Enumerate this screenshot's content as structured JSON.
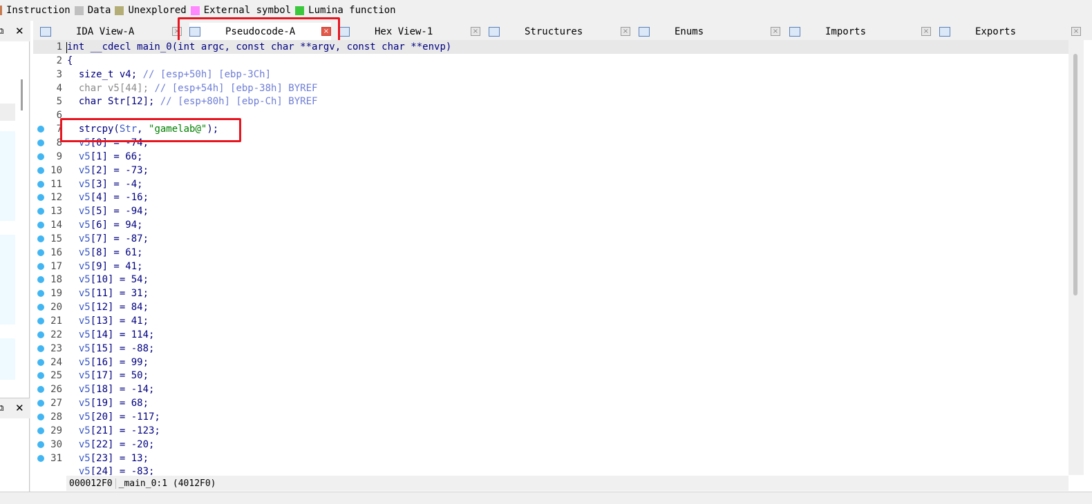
{
  "legend": {
    "items": [
      {
        "label": "Instruction",
        "color": "#c87b52"
      },
      {
        "label": "Data",
        "color": "#c0c0c0"
      },
      {
        "label": "Unexplored",
        "color": "#b4ae76"
      },
      {
        "label": "External symbol",
        "color": "#ff88ff"
      },
      {
        "label": "Lumina function",
        "color": "#3cc83c"
      }
    ]
  },
  "tabs": [
    {
      "label": "IDA View-A",
      "icon": "ida-view-icon",
      "close": "×"
    },
    {
      "label": "Pseudocode-A",
      "icon": "pseudocode-icon",
      "close": "×"
    },
    {
      "label": "Hex View-1",
      "icon": "hex-view-icon",
      "close": "×"
    },
    {
      "label": "Structures",
      "icon": "structures-icon",
      "close": "×"
    },
    {
      "label": "Enums",
      "icon": "enums-icon",
      "close": "×"
    },
    {
      "label": "Imports",
      "icon": "imports-icon",
      "close": "×"
    },
    {
      "label": "Exports",
      "icon": "exports-icon",
      "close": "×"
    }
  ],
  "dock": {
    "restore": "⧉",
    "close": "✕"
  },
  "code": {
    "lines": [
      {
        "n": "1",
        "bp": false,
        "parts": [
          [
            "kw",
            "int __cdecl main_0(int argc, const char **argv, const char **envp)"
          ]
        ]
      },
      {
        "n": "2",
        "bp": false,
        "parts": [
          [
            "kw",
            "{"
          ]
        ]
      },
      {
        "n": "3",
        "bp": false,
        "parts": [
          [
            "kw",
            "  size_t v4; "
          ],
          [
            "cmt",
            "// [esp+50h] [ebp-3Ch]"
          ]
        ]
      },
      {
        "n": "4",
        "bp": false,
        "parts": [
          [
            "gray",
            "  char v5[44]; "
          ],
          [
            "cmt",
            "// [esp+54h] [ebp-38h] BYREF"
          ]
        ]
      },
      {
        "n": "5",
        "bp": false,
        "parts": [
          [
            "kw",
            "  char Str[12]; "
          ],
          [
            "cmt",
            "// [esp+80h] [ebp-Ch] BYREF"
          ]
        ]
      },
      {
        "n": "6",
        "bp": false,
        "parts": [
          [
            "kw",
            ""
          ]
        ]
      },
      {
        "n": "7",
        "bp": true,
        "parts": [
          [
            "kw",
            "  strcpy("
          ],
          [
            "var",
            "Str"
          ],
          [
            "kw",
            ", "
          ],
          [
            "str",
            "\"gamelab@\""
          ],
          [
            "kw",
            ");"
          ]
        ]
      },
      {
        "n": "8",
        "bp": true,
        "parts": [
          [
            "var",
            "  v5"
          ],
          [
            "kw",
            "[0] = -74;"
          ]
        ]
      },
      {
        "n": "9",
        "bp": true,
        "parts": [
          [
            "var",
            "  v5"
          ],
          [
            "kw",
            "[1] = 66;"
          ]
        ]
      },
      {
        "n": "10",
        "bp": true,
        "parts": [
          [
            "var",
            "  v5"
          ],
          [
            "kw",
            "[2] = -73;"
          ]
        ]
      },
      {
        "n": "11",
        "bp": true,
        "parts": [
          [
            "var",
            "  v5"
          ],
          [
            "kw",
            "[3] = -4;"
          ]
        ]
      },
      {
        "n": "12",
        "bp": true,
        "parts": [
          [
            "var",
            "  v5"
          ],
          [
            "kw",
            "[4] = -16;"
          ]
        ]
      },
      {
        "n": "13",
        "bp": true,
        "parts": [
          [
            "var",
            "  v5"
          ],
          [
            "kw",
            "[5] = -94;"
          ]
        ]
      },
      {
        "n": "14",
        "bp": true,
        "parts": [
          [
            "var",
            "  v5"
          ],
          [
            "kw",
            "[6] = 94;"
          ]
        ]
      },
      {
        "n": "15",
        "bp": true,
        "parts": [
          [
            "var",
            "  v5"
          ],
          [
            "kw",
            "[7] = -87;"
          ]
        ]
      },
      {
        "n": "16",
        "bp": true,
        "parts": [
          [
            "var",
            "  v5"
          ],
          [
            "kw",
            "[8] = 61;"
          ]
        ]
      },
      {
        "n": "17",
        "bp": true,
        "parts": [
          [
            "var",
            "  v5"
          ],
          [
            "kw",
            "[9] = 41;"
          ]
        ]
      },
      {
        "n": "18",
        "bp": true,
        "parts": [
          [
            "var",
            "  v5"
          ],
          [
            "kw",
            "[10] = 54;"
          ]
        ]
      },
      {
        "n": "19",
        "bp": true,
        "parts": [
          [
            "var",
            "  v5"
          ],
          [
            "kw",
            "[11] = 31;"
          ]
        ]
      },
      {
        "n": "20",
        "bp": true,
        "parts": [
          [
            "var",
            "  v5"
          ],
          [
            "kw",
            "[12] = 84;"
          ]
        ]
      },
      {
        "n": "21",
        "bp": true,
        "parts": [
          [
            "var",
            "  v5"
          ],
          [
            "kw",
            "[13] = 41;"
          ]
        ]
      },
      {
        "n": "22",
        "bp": true,
        "parts": [
          [
            "var",
            "  v5"
          ],
          [
            "kw",
            "[14] = 114;"
          ]
        ]
      },
      {
        "n": "23",
        "bp": true,
        "parts": [
          [
            "var",
            "  v5"
          ],
          [
            "kw",
            "[15] = -88;"
          ]
        ]
      },
      {
        "n": "24",
        "bp": true,
        "parts": [
          [
            "var",
            "  v5"
          ],
          [
            "kw",
            "[16] = 99;"
          ]
        ]
      },
      {
        "n": "25",
        "bp": true,
        "parts": [
          [
            "var",
            "  v5"
          ],
          [
            "kw",
            "[17] = 50;"
          ]
        ]
      },
      {
        "n": "26",
        "bp": true,
        "parts": [
          [
            "var",
            "  v5"
          ],
          [
            "kw",
            "[18] = -14;"
          ]
        ]
      },
      {
        "n": "27",
        "bp": true,
        "parts": [
          [
            "var",
            "  v5"
          ],
          [
            "kw",
            "[19] = 68;"
          ]
        ]
      },
      {
        "n": "28",
        "bp": true,
        "parts": [
          [
            "var",
            "  v5"
          ],
          [
            "kw",
            "[20] = -117;"
          ]
        ]
      },
      {
        "n": "29",
        "bp": true,
        "parts": [
          [
            "var",
            "  v5"
          ],
          [
            "kw",
            "[21] = -123;"
          ]
        ]
      },
      {
        "n": "30",
        "bp": true,
        "parts": [
          [
            "var",
            "  v5"
          ],
          [
            "kw",
            "[22] = -20;"
          ]
        ]
      },
      {
        "n": "31",
        "bp": true,
        "parts": [
          [
            "var",
            "  v5"
          ],
          [
            "kw",
            "[23] = 13;"
          ]
        ]
      },
      {
        "n": "",
        "bp": false,
        "parts": [
          [
            "var",
            "  v5"
          ],
          [
            "kw",
            "[24] = -83;"
          ]
        ]
      }
    ]
  },
  "status": {
    "address": "000012F0",
    "location": "_main_0:1 (4012F0)"
  },
  "colors": {
    "highlight_box": "#e8141e",
    "breakpoint": "#41b6f2"
  }
}
